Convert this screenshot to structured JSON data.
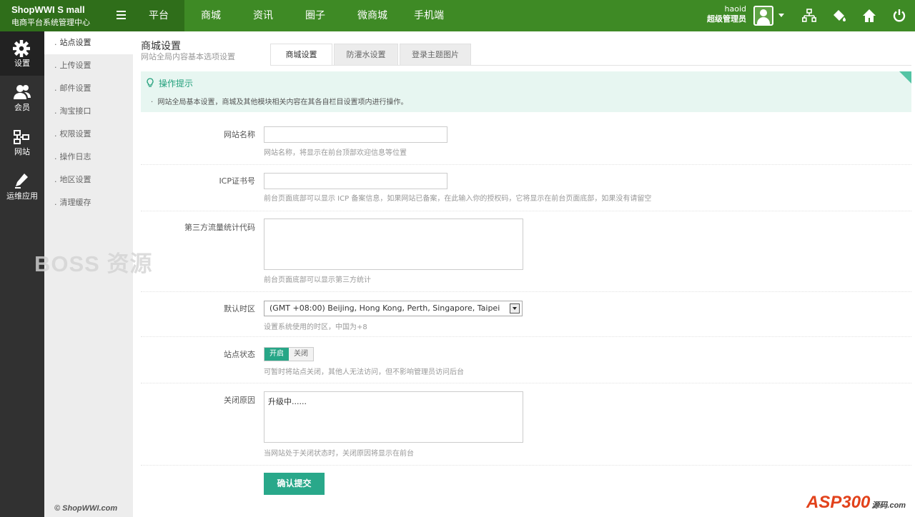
{
  "brand": {
    "name": "ShopWWI S mall",
    "subtitle": "电商平台系统管理中心"
  },
  "nav": {
    "items": [
      "平台",
      "商城",
      "资讯",
      "圈子",
      "微商城",
      "手机端"
    ],
    "active": "平台"
  },
  "user": {
    "name": "haoid",
    "role": "超级管理员"
  },
  "top_icons": [
    "sitemap-icon",
    "paint-bucket-icon",
    "home-icon",
    "power-icon"
  ],
  "sidebar": {
    "items": [
      {
        "label": "设置",
        "icon": "gear-icon"
      },
      {
        "label": "会员",
        "icon": "users-icon"
      },
      {
        "label": "网站",
        "icon": "sitemap-icon"
      },
      {
        "label": "运维应用",
        "icon": "pen-icon"
      }
    ],
    "active": "设置"
  },
  "submenu": {
    "items": [
      "站点设置",
      "上传设置",
      "邮件设置",
      "淘宝接口",
      "权限设置",
      "操作日志",
      "地区设置",
      "清理缓存"
    ],
    "active": "站点设置"
  },
  "copyright": "© ShopWWI.com",
  "page": {
    "title": "商城设置",
    "subtitle": "网站全局内容基本选项设置"
  },
  "tabs": [
    "商城设置",
    "防灌水设置",
    "登录主题图片"
  ],
  "tips": {
    "title": "操作提示",
    "text": "网站全局基本设置，商城及其他模块相关内容在其各自栏目设置项内进行操作。"
  },
  "form": {
    "site_name": {
      "label": "网站名称",
      "value": "",
      "hint": "网站名称，将显示在前台顶部欢迎信息等位置"
    },
    "icp": {
      "label": "ICP证书号",
      "value": "",
      "hint": "前台页面底部可以显示 ICP 备案信息，如果网站已备案，在此输入你的授权码，它将显示在前台页面底部，如果没有请留空"
    },
    "stat_code": {
      "label": "第三方流量统计代码",
      "value": "",
      "hint": "前台页面底部可以显示第三方统计"
    },
    "timezone": {
      "label": "默认时区",
      "value": "(GMT +08:00) Beijing, Hong Kong, Perth, Singapore, Taipei",
      "hint": "设置系统使用的时区，中国为+8"
    },
    "site_status": {
      "label": "站点状态",
      "on_label": "开启",
      "off_label": "关闭",
      "value": "开启",
      "hint": "可暂时将站点关闭，其他人无法访问，但不影响管理员访问后台"
    },
    "close_reason": {
      "label": "关闭原因",
      "value": "升级中......",
      "hint": "当网站处于关闭状态时，关闭原因将显示在前台"
    },
    "submit_label": "确认提交"
  },
  "watermarks": {
    "left": "BOSS 资源",
    "bottom_right": "ASP300",
    "bottom_right_sub": "源码.com"
  },
  "colors": {
    "top_bar": "#3e8a25",
    "accent": "#29a88a",
    "sidebar": "#313131"
  }
}
